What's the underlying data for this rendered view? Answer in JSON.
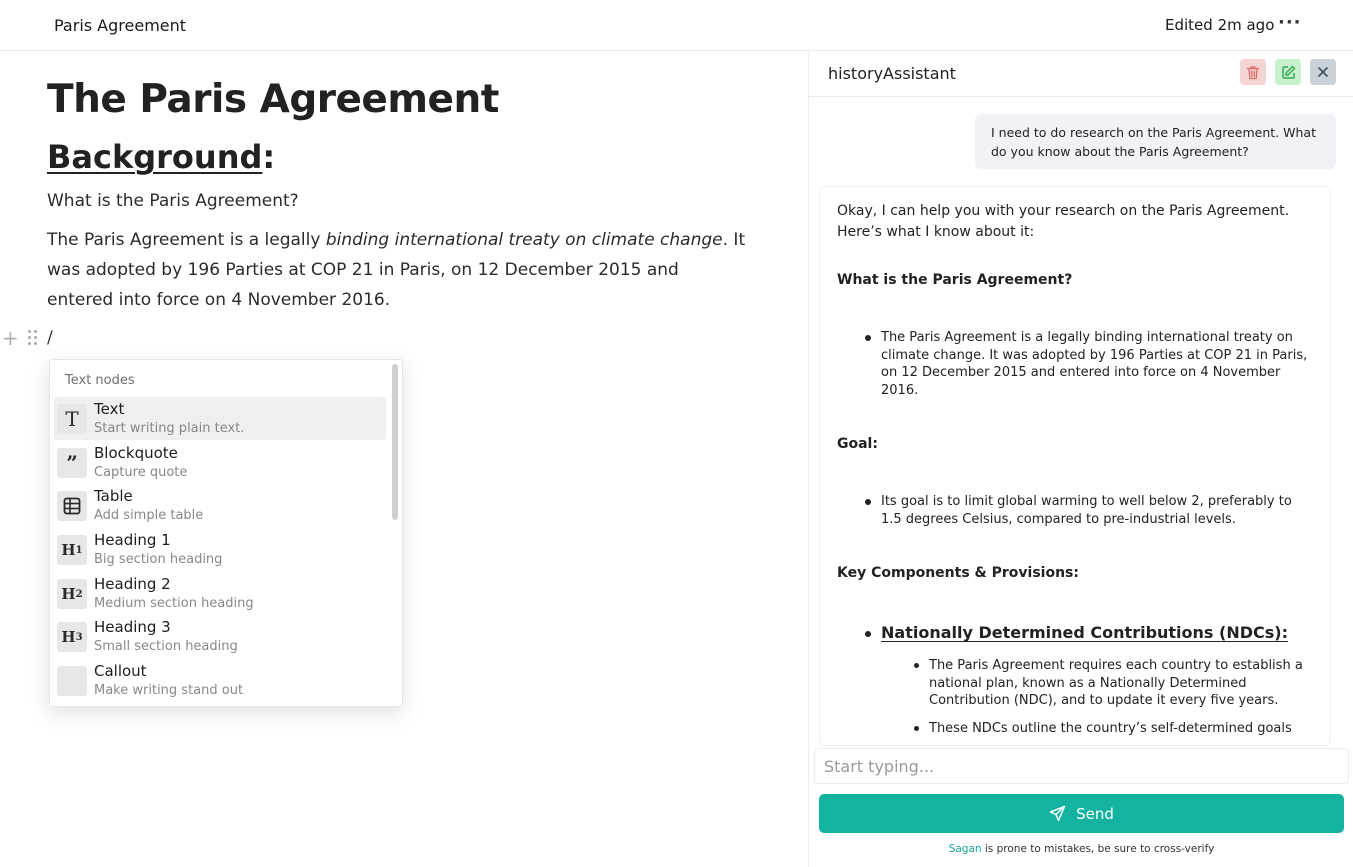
{
  "topbar": {
    "doc_title": "Paris Agreement",
    "edited": "Edited 2m ago",
    "more": "···"
  },
  "editor": {
    "title": "The Paris Agreement",
    "heading_text": "Background",
    "heading_colon": ":",
    "question": "What is the Paris Agreement?",
    "para_a": "The Paris Agreement is a legally ",
    "para_em": "binding international treaty on climate change",
    "para_b": ". It was adopted by 196 Parties at COP 21 in Paris, on 12 December 2015 and entered into force on 4 November 2016.",
    "slash": "/"
  },
  "menu": {
    "header": "Text nodes",
    "items": [
      {
        "icon": "T",
        "title": "Text",
        "subtitle": "Start writing plain text."
      },
      {
        "icon": "99",
        "title": "Blockquote",
        "subtitle": "Capture quote"
      },
      {
        "icon": "table",
        "title": "Table",
        "subtitle": "Add simple table"
      },
      {
        "icon": "H1",
        "title": "Heading 1",
        "subtitle": "Big section heading"
      },
      {
        "icon": "H2",
        "title": "Heading 2",
        "subtitle": "Medium section heading"
      },
      {
        "icon": "H3",
        "title": "Heading 3",
        "subtitle": "Small section heading"
      },
      {
        "icon": "callout",
        "title": "Callout",
        "subtitle": "Make writing stand out"
      }
    ]
  },
  "assistant": {
    "name": "historyAssistant",
    "user_message": "I need to do research on the Paris Agreement. What do you know about the Paris Agreement?",
    "answer": {
      "intro": "Okay, I can help you with your research on the Paris Agreement. Here’s what I know about it:",
      "section1": "What is the Paris Agreement?",
      "bullet1": "The Paris Agreement is a legally binding international treaty on climate change. It was adopted by 196 Parties at COP 21 in Paris, on 12 December 2015 and entered into force on 4 November 2016.",
      "section2": "Goal:",
      "bullet2": "Its goal is to limit global warming to well below 2, preferably to 1.5 degrees Celsius, compared to pre-industrial levels.",
      "section3": "Key Components & Provisions:",
      "subheading": "Nationally Determined Contributions (NDCs):",
      "sub_bullet1": "The Paris Agreement requires each country to establish a national plan, known as a Nationally Determined Contribution (NDC), and to update it every five years.",
      "sub_bullet2": "These NDCs outline the country’s self-determined goals"
    },
    "input_placeholder": "Start typing...",
    "send_label": "Send",
    "disclaimer_brand": "Sagan",
    "disclaimer_text": " is prone to mistakes, be sure to cross-verify"
  },
  "colors": {
    "accent": "#13b3a0",
    "delete_bg": "#f7d4d4",
    "edit_bg": "#c9efcf",
    "close_bg": "#c8d0d8"
  }
}
